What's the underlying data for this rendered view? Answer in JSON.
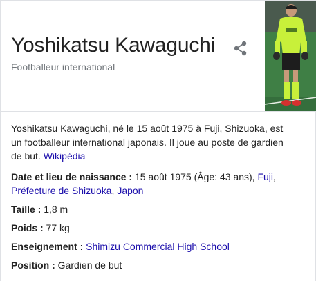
{
  "header": {
    "title": "Yoshikatsu Kawaguchi",
    "subtitle": "Footballeur international",
    "share_icon": "share-icon"
  },
  "photo": {
    "alt": "Yoshikatsu Kawaguchi",
    "jersey_color": "#c8f03a",
    "sponsor_text": "NAMIHA"
  },
  "description": {
    "text": "Yoshikatsu Kawaguchi, né le 15 août 1975 à Fuji, Shizuoka, est un footballeur international japonais. Il joue au poste de gardien de but.",
    "source_link": "Wikipédia"
  },
  "facts": {
    "birth": {
      "label": "Date et lieu de naissance :",
      "value": " 15 août 1975 (Âge: 43 ans), ",
      "link1": "Fuji",
      "sep": ", ",
      "link2": "Préfecture de Shizuoka",
      "sep2": ", ",
      "link3": "Japon"
    },
    "height": {
      "label": "Taille :",
      "value": " 1,8 m"
    },
    "weight": {
      "label": "Poids :",
      "value": " 77 kg"
    },
    "education": {
      "label": "Enseignement :",
      "link": "Shimizu Commercial High School"
    },
    "position": {
      "label": "Position :",
      "value": " Gardien de but"
    }
  },
  "colors": {
    "link": "#1a0dab",
    "subtitle": "#70757a",
    "divider": "#dfe1e5"
  }
}
